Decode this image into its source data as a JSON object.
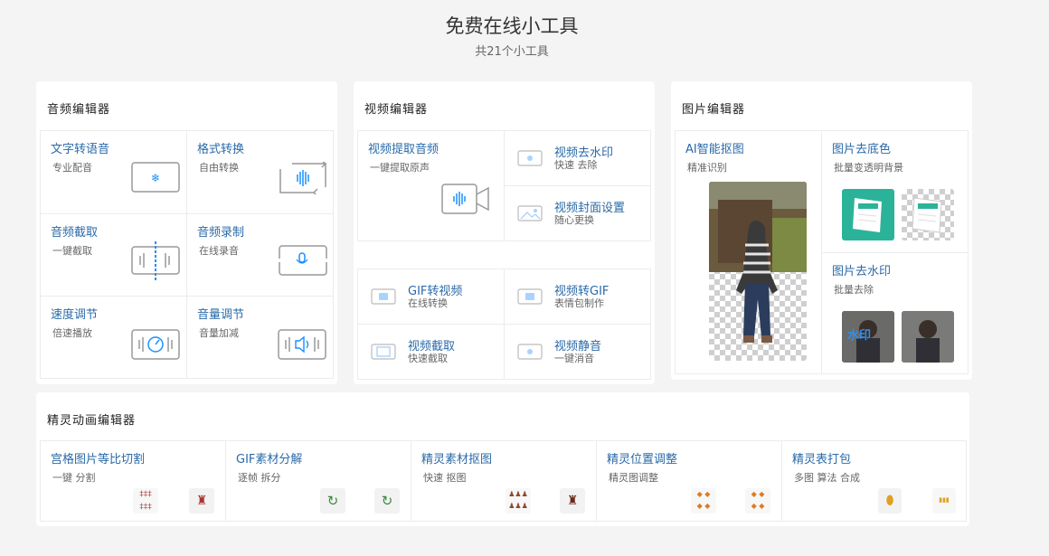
{
  "page": {
    "title": "免费在线小工具",
    "subtitle": "共21个小工具"
  },
  "audio": {
    "title": "音频编辑器",
    "items": [
      {
        "label": "文字转语音",
        "desc": "专业配音"
      },
      {
        "label": "格式转换",
        "desc": "自由转换"
      },
      {
        "label": "音频截取",
        "desc": "一键截取"
      },
      {
        "label": "音频录制",
        "desc": "在线录音"
      },
      {
        "label": "速度调节",
        "desc": "倍速播放"
      },
      {
        "label": "音量调节",
        "desc": "音量加减"
      }
    ]
  },
  "video": {
    "title": "视频编辑器",
    "items": [
      {
        "label": "视频提取音频",
        "desc": "一键提取原声"
      },
      {
        "label": "视频去水印",
        "desc": "快速 去除"
      },
      {
        "label": "视频封面设置",
        "desc": "随心更换"
      },
      {
        "label": "GIF转视频",
        "desc": "在线转换"
      },
      {
        "label": "视频转GIF",
        "desc": "表情包制作"
      },
      {
        "label": "视频截取",
        "desc": "快速截取"
      },
      {
        "label": "视频静音",
        "desc": "一键消音"
      }
    ]
  },
  "image": {
    "title": "图片编辑器",
    "items": [
      {
        "label": "AI智能抠图",
        "desc": "精准识别"
      },
      {
        "label": "图片去底色",
        "desc": "批量变透明背景"
      },
      {
        "label": "图片去水印",
        "desc": "批量去除"
      }
    ],
    "watermark_text": "水印"
  },
  "sprite": {
    "title": "精灵动画编辑器",
    "items": [
      {
        "label": "宫格图片等比切割",
        "desc": "一键 分割"
      },
      {
        "label": "GIF素材分解",
        "desc": "逐帧 拆分"
      },
      {
        "label": "精灵素材抠图",
        "desc": "快速 抠图"
      },
      {
        "label": "精灵位置调整",
        "desc": "精灵图调整"
      },
      {
        "label": "精灵表打包",
        "desc": "多图 算法 合成"
      }
    ]
  },
  "colors": {
    "link": "#2a6aa8",
    "accent": "#1890ff",
    "teal": "#2bb39a"
  }
}
